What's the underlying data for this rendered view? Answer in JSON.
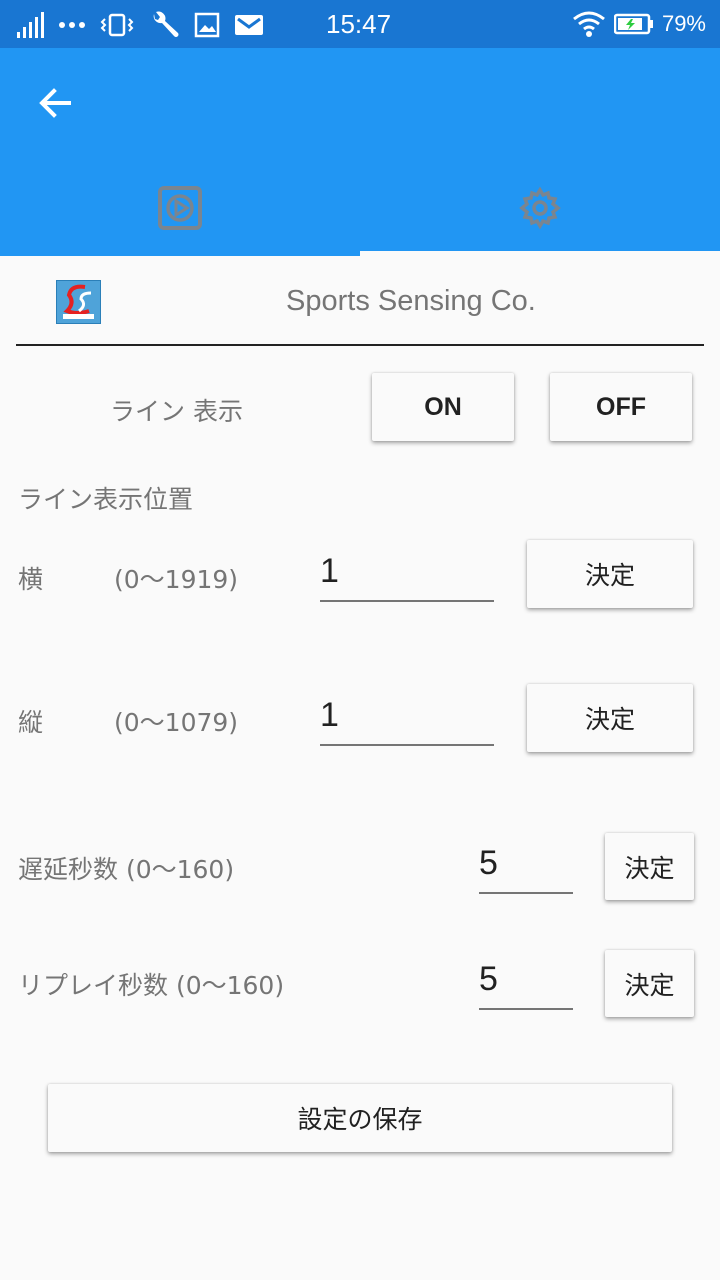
{
  "status_bar": {
    "time": "15:47",
    "battery": "79%",
    "icons": [
      "signal-icon",
      "more-icon",
      "vibrate-icon",
      "wrench-icon",
      "image-icon",
      "mail-icon",
      "wifi-icon",
      "battery-icon"
    ]
  },
  "app_bar": {
    "tabs": [
      {
        "icon": "video-play-icon"
      },
      {
        "icon": "gear-icon"
      }
    ],
    "selected_tab": 1
  },
  "header": {
    "company": "Sports Sensing Co."
  },
  "line_display": {
    "label": "ライン 表示",
    "on_label": "ON",
    "off_label": "OFF"
  },
  "line_position": {
    "section_label": "ライン表示位置",
    "horizontal": {
      "label": "横",
      "range": "(0〜1919)",
      "value": "1",
      "button": "決定"
    },
    "vertical": {
      "label": "縦",
      "range": "(0〜1079)",
      "value": "1",
      "button": "決定"
    }
  },
  "delay": {
    "label": "遅延秒数 (0〜160)",
    "value": "5",
    "button": "決定"
  },
  "replay": {
    "label": "リプレイ秒数 (0〜160)",
    "value": "5",
    "button": "決定"
  },
  "save_label": "設定の保存",
  "colors": {
    "status_bar": "#1976d2",
    "app_bar": "#2196f3",
    "background": "#fafafa"
  }
}
